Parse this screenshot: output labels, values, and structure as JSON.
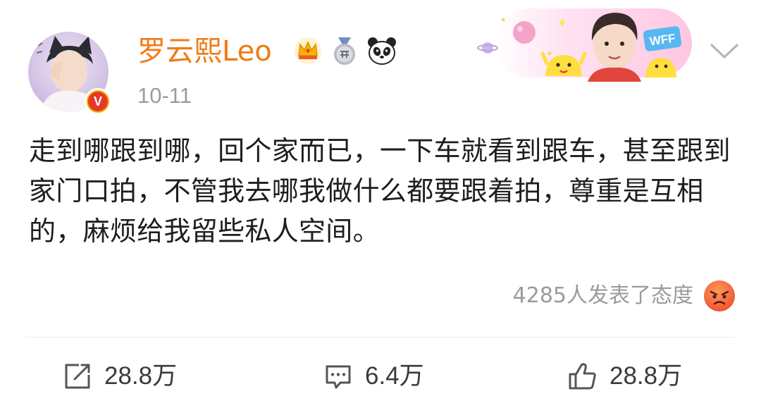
{
  "post": {
    "user": {
      "name": "罗云熙Leo",
      "verified_mark": "V",
      "badges": [
        "crown-icon",
        "answer-medal-icon",
        "panda-icon"
      ]
    },
    "time": "10-11",
    "content": "走到哪跟到哪，回个家而已，一下车就看到跟车，甚至跟到家门口拍，不管我去哪我做什么都要跟着拍，尊重是互相的，麻烦给我留些私人空间。",
    "reaction": {
      "text": "4285人发表了态度",
      "icon": "angry-face-icon"
    },
    "banner": {
      "tag": "WFF"
    }
  },
  "actions": {
    "repost": {
      "icon": "repost-icon",
      "count": "28.8万"
    },
    "comment": {
      "icon": "comment-icon",
      "count": "6.4万"
    },
    "like": {
      "icon": "thumbs-up-icon",
      "count": "28.8万"
    }
  },
  "colors": {
    "username": "#f27a13",
    "text": "#1e1e1e",
    "meta": "#9b9b9b",
    "verified": "#f5b400",
    "reaction_face": "#f06a3f",
    "divider": "#ececec"
  }
}
